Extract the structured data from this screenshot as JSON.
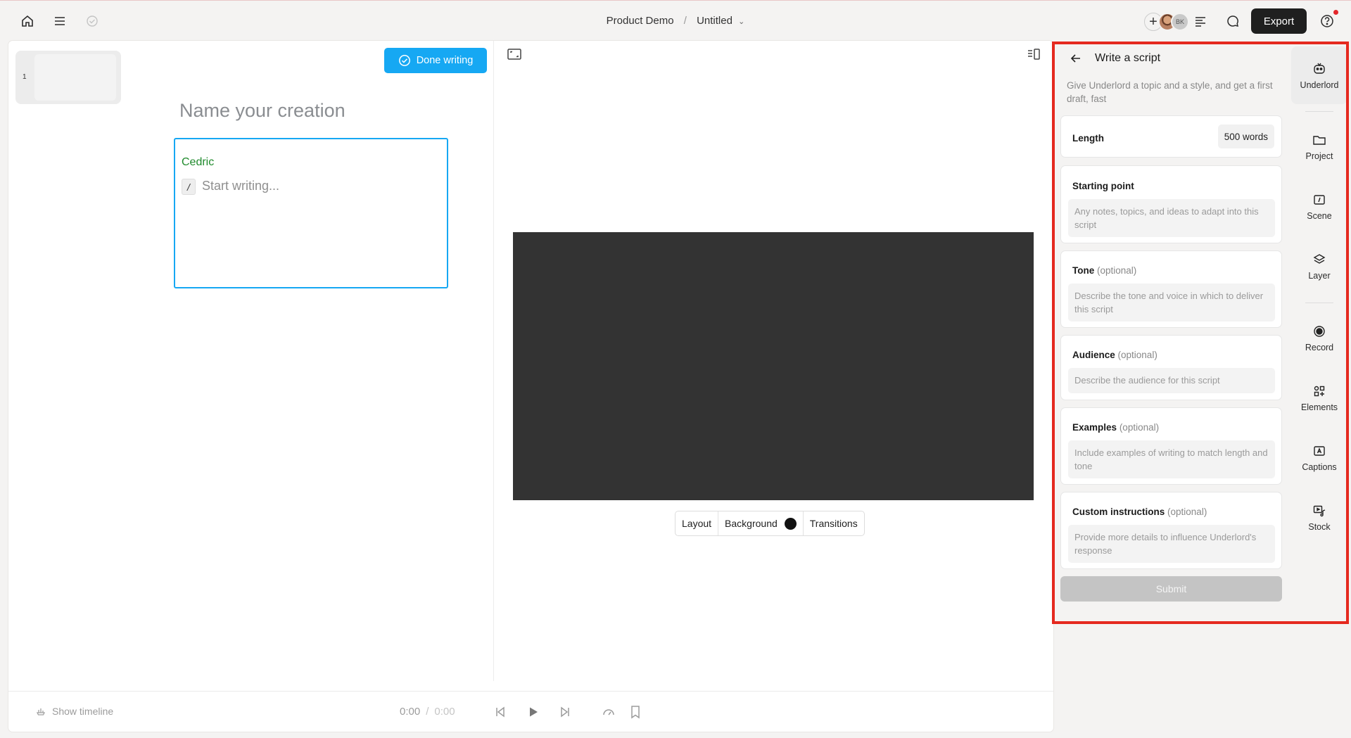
{
  "topbar": {
    "project": "Product Demo",
    "separator": "/",
    "doc_title": "Untitled",
    "avatar_initials": "BK",
    "export_label": "Export"
  },
  "editor": {
    "done_writing": "Done writing",
    "title_placeholder": "Name your creation",
    "speaker": "Cedric",
    "slash": "/",
    "start_writing": "Start writing...",
    "scene_number": "1"
  },
  "scene_controls": {
    "layout": "Layout",
    "background": "Background",
    "background_color": "#111111",
    "transitions": "Transitions"
  },
  "bottom": {
    "show_timeline": "Show timeline",
    "current_time": "0:00",
    "time_sep": "/",
    "total_time": "0:00"
  },
  "script_panel": {
    "title": "Write a script",
    "description": "Give Underlord a topic and a style, and get a first draft, fast",
    "length_label": "Length",
    "length_value": "500 words",
    "fields": [
      {
        "label": "Starting point",
        "optional": "",
        "placeholder": "Any notes, topics, and ideas to adapt into this script"
      },
      {
        "label": "Tone",
        "optional": "(optional)",
        "placeholder": "Describe the tone and voice in which to deliver this script"
      },
      {
        "label": "Audience",
        "optional": "(optional)",
        "placeholder": "Describe the audience for this script"
      },
      {
        "label": "Examples",
        "optional": "(optional)",
        "placeholder": "Include examples of writing to match length and tone"
      },
      {
        "label": "Custom instructions",
        "optional": "(optional)",
        "placeholder": "Provide more details to influence Underlord's response"
      }
    ],
    "submit": "Submit"
  },
  "tools": [
    {
      "label": "Underlord",
      "icon": "robot-icon"
    },
    {
      "label": "Project",
      "icon": "folder-icon"
    },
    {
      "label": "Scene",
      "icon": "scene-icon"
    },
    {
      "label": "Layer",
      "icon": "layers-icon"
    },
    {
      "label": "Record",
      "icon": "record-icon"
    },
    {
      "label": "Elements",
      "icon": "elements-icon"
    },
    {
      "label": "Captions",
      "icon": "captions-icon"
    },
    {
      "label": "Stock",
      "icon": "stock-icon"
    }
  ],
  "colors": {
    "accent": "#16a8f3",
    "highlight": "#e5291f",
    "speaker": "#1f8a2c"
  }
}
